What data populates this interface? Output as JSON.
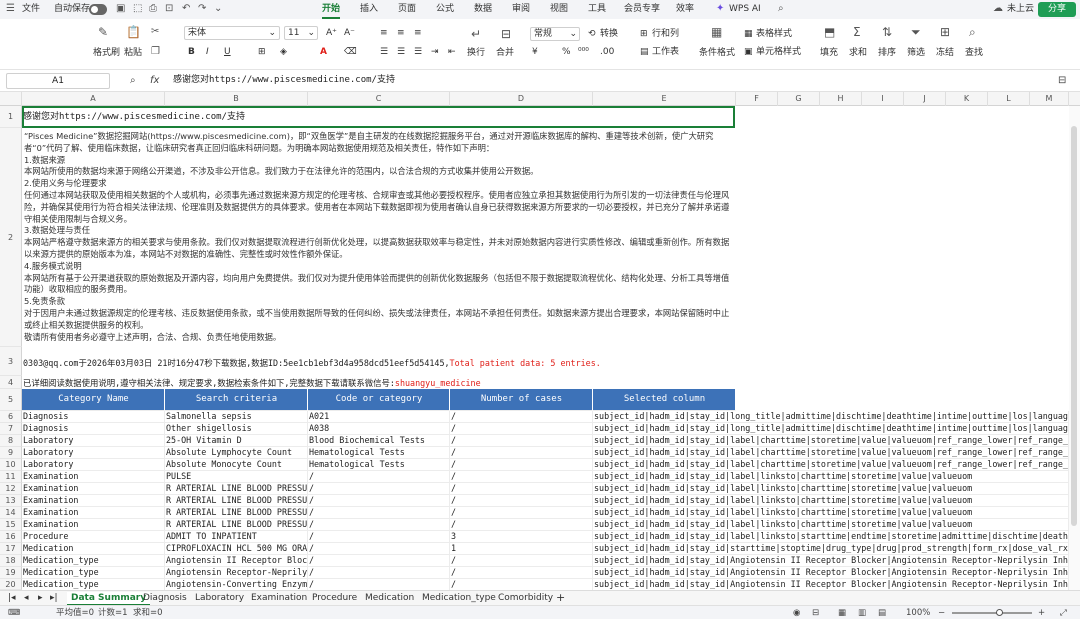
{
  "menu": {
    "file": "文件",
    "autosave": "自动保存",
    "tabs": [
      "开始",
      "插入",
      "页面",
      "公式",
      "数据",
      "审阅",
      "视图",
      "工具",
      "会员专享",
      "效率"
    ],
    "wps_ai": "WPS AI",
    "cloud_status": "未上云",
    "share": "分享"
  },
  "ribbon": {
    "format_painter": "格式刷",
    "paste": "粘贴",
    "font_name": "宋体",
    "font_size": "11",
    "number_format": "常规",
    "convert": "转换",
    "rows_cols": "行和列",
    "wrap": "换行",
    "merge": "合并",
    "worksheet": "工作表",
    "conditional_format": "条件格式",
    "table_style": "表格样式",
    "cell_style": "单元格样式",
    "fill": "填充",
    "sum": "求和",
    "sort": "排序",
    "filter": "筛选",
    "freeze": "冻结",
    "find": "查找"
  },
  "formula_bar": {
    "cell_ref": "A1",
    "content": "感谢您对https://www.piscesmedicine.com/支持"
  },
  "columns": [
    "A",
    "B",
    "C",
    "D",
    "E",
    "F",
    "G",
    "H",
    "I",
    "J",
    "K",
    "L",
    "M"
  ],
  "rows": [
    "1",
    "2",
    "3",
    "4",
    "5",
    "6",
    "7",
    "8",
    "9",
    "10",
    "11",
    "12",
    "13",
    "14",
    "15",
    "16",
    "17",
    "18",
    "19",
    "20"
  ],
  "sheet": {
    "a1": "感谢您对https://www.piscesmedicine.com/支持",
    "disclaimer": "“Pisces Medicine”数据挖掘网站(https://www.piscesmedicine.com)，即“双鱼医学”是自主研发的在线数据挖掘服务平台，通过对开源临床数据库的解构、重建等技术创新，使广大研究者“0”代码了解、使用临床数据，让临床研究者真正回归临床科研问题。为明确本网站数据使用规范及相关责任，特作如下声明：\n1.数据来源\n本网站所使用的数据均来源于网络公开渠道，不涉及非公开信息。我们致力于在法律允许的范围内，以合法合规的方式收集并使用公开数据。\n2.使用义务与伦理要求\n任何通过本网站获取及使用相关数据的个人或机构，必须事先通过数据来源方规定的伦理考核、合规审查或其他必要授权程序。使用者应独立承担其数据使用行为所引发的一切法律责任与伦理风险，并确保其使用行为符合相关法律法规、伦理准则及数据提供方的具体要求。使用者在本网站下载数据即视为使用者确认自身已获得数据来源方所要求的一切必要授权，并已充分了解并承诺遵守相关使用限制与合规义务。\n3.数据处理与责任\n本网站严格遵守数据来源方的相关要求与使用条款。我们仅对数据提取流程进行创新优化处理，以提高数据获取效率与稳定性，并未对原始数据内容进行实质性修改、编辑或重新创作。所有数据以来源方提供的原始版本为准，本网站不对数据的准确性、完整性或时效性作额外保证。\n4.服务模式说明\n本网站所有基于公开渠道获取的原始数据及开源内容，均向用户免费提供。我们仅对为提升使用体验而提供的创新优化数据服务（包括但不限于数据提取流程优化、结构化处理、分析工具等增值功能）收取相应的服务费用。\n5.免责条款\n对于因用户未通过数据源规定的伦理考核、违反数据使用条款，或不当使用数据所导致的任何纠纷、损失或法律责任，本网站不承担任何责任。如数据来源方提出合理要求，本网站保留随时中止或终止相关数据提供服务的权利。\n敬请所有使用者务必遵守上述声明，合法、合规、负责任地使用数据。",
    "download_info": "0303@qq.com于2026年03月03日 21时16分47秒下载数据,数据ID:5ee1cb1ebf3d4a958dcd51eef5d54145,",
    "total_patients": "Total patient data: 5 entries.",
    "agreement": "已详细阅读数据使用说明,遵守相关法律、规定要求,数据检索条件如下,完整数据下载请联系微信号:",
    "wechat_id": "shuangyu_medicine"
  },
  "table": {
    "headers": [
      "Category Name",
      "Search criteria",
      "Code or category",
      "Number of cases",
      "Selected column"
    ],
    "rows": [
      [
        "Diagnosis",
        "Salmonella sepsis",
        "A021",
        "/",
        "subject_id|hadm_id|stay_id|long_title|admittime|dischtime|deathtime|intime|outtime|los|language|race|ho"
      ],
      [
        "Diagnosis",
        "Other shigellosis",
        "A038",
        "/",
        "subject_id|hadm_id|stay_id|long_title|admittime|dischtime|deathtime|intime|outtime|los|language|race|ho"
      ],
      [
        "Laboratory",
        "25-OH Vitamin D",
        "Blood Biochemical Tests",
        "/",
        "subject_id|hadm_id|stay_id|label|charttime|storetime|value|valueuom|ref_range_lower|ref_range_upper"
      ],
      [
        "Laboratory",
        "Absolute Lymphocyte Count",
        "Hematological Tests",
        "/",
        "subject_id|hadm_id|stay_id|label|charttime|storetime|value|valueuom|ref_range_lower|ref_range_upper"
      ],
      [
        "Laboratory",
        "Absolute Monocyte Count",
        "Hematological Tests",
        "/",
        "subject_id|hadm_id|stay_id|label|charttime|storetime|value|valueuom|ref_range_lower|ref_range_upper"
      ],
      [
        "Examination",
        "PULSE",
        "/",
        "/",
        "subject_id|hadm_id|stay_id|label|linksto|charttime|storetime|value|valueuom"
      ],
      [
        "Examination",
        "R ARTERIAL LINE BLOOD PRESSURE",
        "/",
        "/",
        "subject_id|hadm_id|stay_id|label|linksto|charttime|storetime|value|valueuom"
      ],
      [
        "Examination",
        "R ARTERIAL LINE BLOOD PRESSURE",
        "/",
        "/",
        "subject_id|hadm_id|stay_id|label|linksto|charttime|storetime|value|valueuom"
      ],
      [
        "Examination",
        "R ARTERIAL LINE BLOOD PRESSURE",
        "/",
        "/",
        "subject_id|hadm_id|stay_id|label|linksto|charttime|storetime|value|valueuom"
      ],
      [
        "Examination",
        "R ARTERIAL LINE BLOOD PRESSURE",
        "/",
        "/",
        "subject_id|hadm_id|stay_id|label|linksto|charttime|storetime|value|valueuom"
      ],
      [
        "Procedure",
        "ADMIT TO INPATIENT",
        "/",
        "3",
        "subject_id|hadm_id|stay_id|label|linksto|starttime|endtime|storetime|admittime|dischtime|deathtime|inti"
      ],
      [
        "Medication",
        "CIPROFLOXACIN HCL 500 MG ORAL",
        "/",
        "1",
        "subject_id|hadm_id|stay_id|starttime|stoptime|drug_type|drug|prod_strength|form_rx|dose_val_rx|dose_uni"
      ],
      [
        "Medication_type",
        "Angiotensin II Receptor Blocker",
        "/",
        "/",
        "subject_id|hadm_id|stay_id|Angiotensin II Receptor Blocker|Angiotensin Receptor-Neprilysin Inhibitor|An"
      ],
      [
        "Medication_type",
        "Angiotensin Receptor-Neprilysin",
        "/",
        "/",
        "subject_id|hadm_id|stay_id|Angiotensin II Receptor Blocker|Angiotensin Receptor-Neprilysin Inhibitor|An"
      ],
      [
        "Medication_type",
        "Angiotensin-Converting Enzyme",
        "/",
        "/",
        "subject_id|hadm_id|stay_id|Angiotensin II Receptor Blocker|Angiotensin Receptor-Neprilysin Inhibitor|An"
      ]
    ]
  },
  "sheet_tabs": [
    "Data Summary",
    "Diagnosis",
    "Laboratory",
    "Examination",
    "Procedure",
    "Medication",
    "Medication_type",
    "Comorbidity"
  ],
  "add_sheet": "+",
  "status": {
    "average": "平均值=0",
    "count": "计数=1",
    "sum": "求和=0",
    "zoom": "100%"
  },
  "colors": {
    "accent": "#1a7f37",
    "header_blue": "#3d72b8",
    "red_text": "#e0201a"
  }
}
